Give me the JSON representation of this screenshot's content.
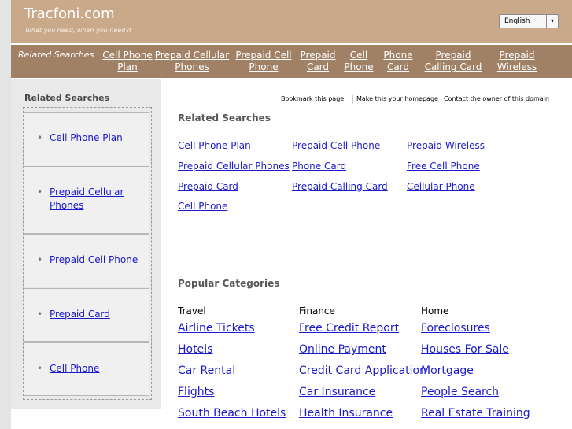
{
  "header": {
    "site_title": "Tracfoni.com",
    "tagline": "What you need, when you need it",
    "language": "English",
    "language_arrow": "▾"
  },
  "top_nav": {
    "label": "Related Searches",
    "items": [
      {
        "line1": "Cell Phone",
        "line2": "Plan"
      },
      {
        "line1": "Prepaid Cellular",
        "line2": "Phones"
      },
      {
        "line1": "Prepaid Cell",
        "line2": "Phone"
      },
      {
        "line1": "Prepaid",
        "line2": "Card"
      },
      {
        "line1": "Cell",
        "line2": "Phone"
      },
      {
        "line1": "Phone",
        "line2": "Card"
      },
      {
        "line1": "Prepaid",
        "line2": "Calling Card"
      },
      {
        "line1": "Prepaid",
        "line2": "Wireless"
      }
    ]
  },
  "sidebar": {
    "title": "Related Searches",
    "bullet": "•",
    "items": [
      {
        "line1": "Cell Phone Plan",
        "line2": ""
      },
      {
        "line1": "Prepaid Cellular",
        "line2": "Phones"
      },
      {
        "line1": "Prepaid Cell Phone",
        "line2": ""
      },
      {
        "line1": "Prepaid Card",
        "line2": ""
      },
      {
        "line1": "Cell Phone",
        "line2": ""
      }
    ]
  },
  "top_links": {
    "bookmark": "Bookmark this page",
    "separator": "|",
    "homepage": "Make this your homepage",
    "contact": "Contact the owner of this domain"
  },
  "related_searches": {
    "heading": "Related Searches",
    "links": [
      "Cell Phone Plan",
      "Prepaid Cell Phone",
      "Prepaid Wireless",
      "Prepaid Cellular Phones",
      "Phone Card",
      "Free Cell Phone",
      "Prepaid Card",
      "Prepaid Calling Card",
      "Cellular Phone",
      "Cell Phone"
    ]
  },
  "popular_categories": {
    "heading": "Popular Categories",
    "columns": [
      {
        "title": "Travel",
        "links": [
          "Airline Tickets",
          "Hotels",
          "Car Rental",
          "Flights",
          "South Beach Hotels"
        ]
      },
      {
        "title": "Finance",
        "links": [
          "Free Credit Report",
          "Online Payment",
          "Credit Card Application",
          "Car Insurance",
          "Health Insurance"
        ]
      },
      {
        "title": "Home",
        "links": [
          "Foreclosures",
          "Houses For Sale",
          "Mortgage",
          "People Search",
          "Real Estate Training"
        ]
      }
    ]
  },
  "colors": {
    "header_bg": "#c9a98a",
    "nav_bg": "#a08165",
    "link": "#1a1acc",
    "sidebar_bg": "#e9e9e9"
  }
}
